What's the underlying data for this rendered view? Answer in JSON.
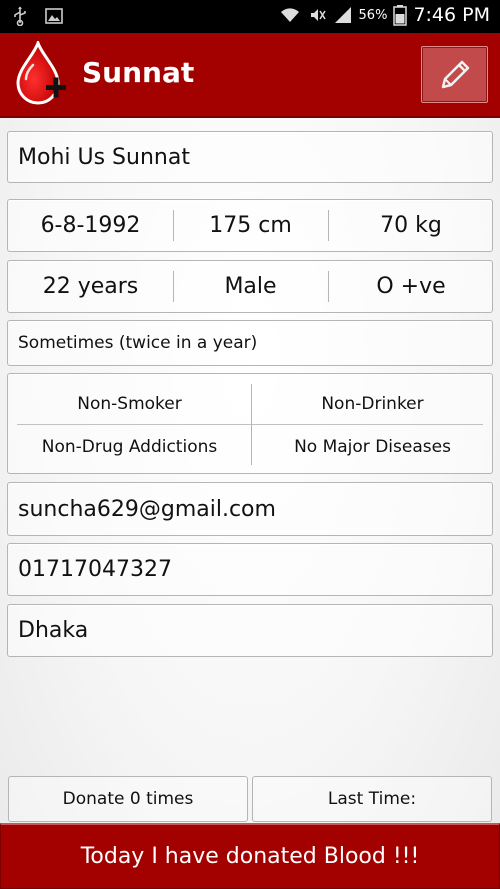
{
  "status_bar": {
    "battery_percent": "56%",
    "time": "7:46 PM",
    "icons": [
      "usb-icon",
      "image-icon",
      "wifi-icon",
      "mute-icon",
      "signal-icon",
      "battery-icon"
    ]
  },
  "action_bar": {
    "title": "Sunnat",
    "logo_icon": "blood-drop-plus-icon",
    "edit_icon": "pencil-icon"
  },
  "profile": {
    "name": "Mohi Us Sunnat",
    "dob": "6-8-1992",
    "height": "175 cm",
    "weight": "70 kg",
    "age": "22 years",
    "gender": "Male",
    "blood_group": "O +ve",
    "donation_frequency": "Sometimes (twice in a year)",
    "habits": {
      "smoking": "Non-Smoker",
      "drinking": "Non-Drinker",
      "drugs": "Non-Drug Addictions",
      "diseases": "No Major Diseases"
    },
    "email": "suncha629@gmail.com",
    "phone": "01717047327",
    "city": "Dhaka"
  },
  "footer": {
    "donate_count": "Donate 0 times",
    "last_time": "Last Time:",
    "donate_button": "Today I have donated Blood !!!"
  },
  "colors": {
    "primary_red": "#a30000",
    "status_bar": "#000000"
  }
}
